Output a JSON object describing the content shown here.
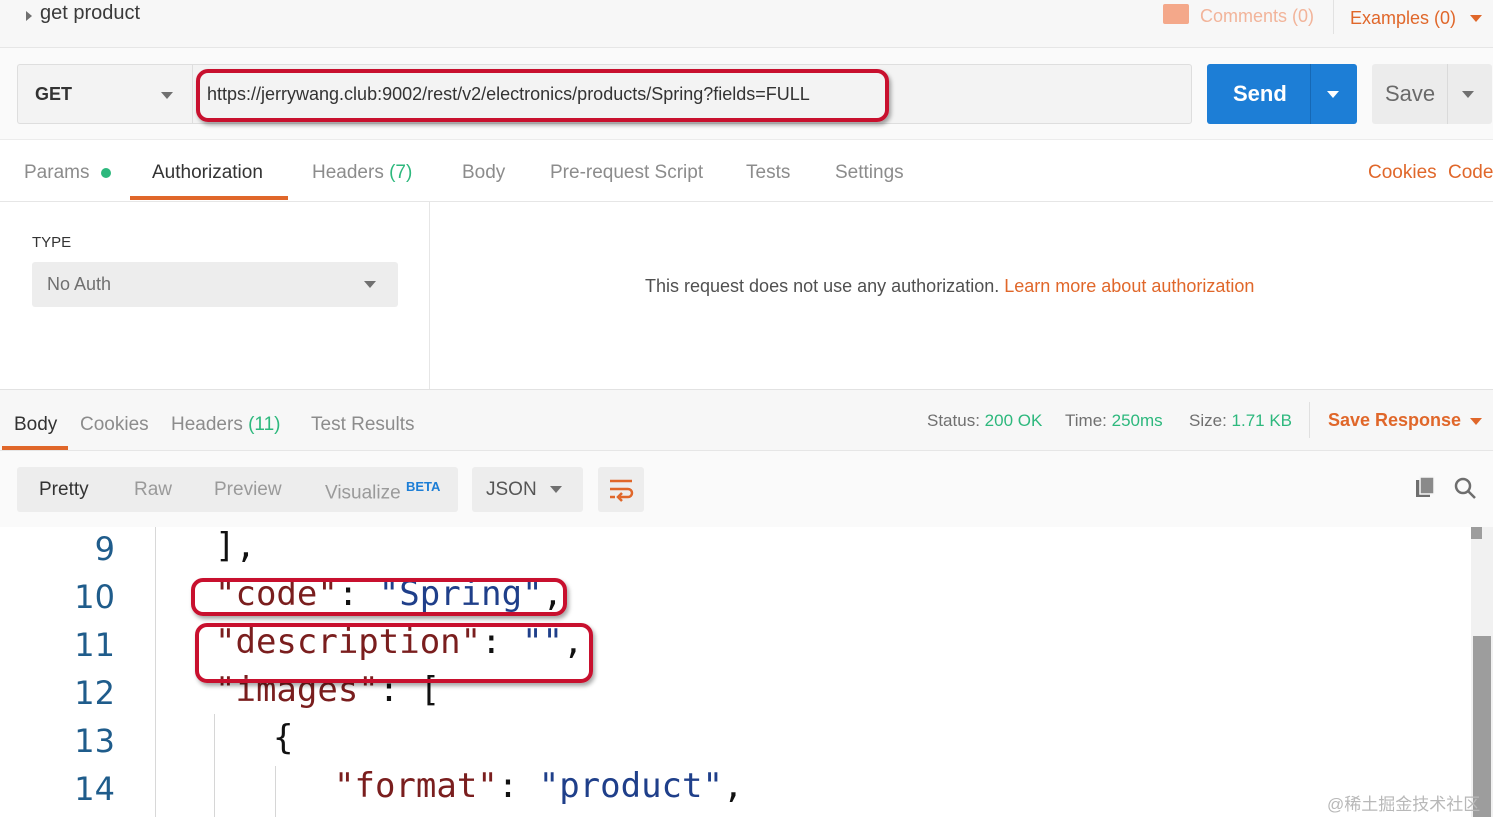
{
  "header": {
    "request_name": "get product",
    "comments_label": "Comments (0)",
    "examples_label": "Examples (0)"
  },
  "request": {
    "method": "GET",
    "url": "https://jerrywang.club:9002/rest/v2/electronics/products/Spring?fields=FULL",
    "send_label": "Send",
    "save_label": "Save"
  },
  "request_tabs": {
    "params": "Params",
    "authorization": "Authorization",
    "headers": "Headers",
    "headers_count": "(7)",
    "body": "Body",
    "prerequest": "Pre-request Script",
    "tests": "Tests",
    "settings": "Settings",
    "cookies": "Cookies",
    "code": "Code",
    "active": "Authorization"
  },
  "auth": {
    "type_label": "TYPE",
    "type_value": "No Auth",
    "message": "This request does not use any authorization.",
    "learn_more": "Learn more about authorization"
  },
  "response": {
    "tabs": {
      "body": "Body",
      "cookies": "Cookies",
      "headers": "Headers",
      "headers_count": "(11)",
      "test_results": "Test Results"
    },
    "status_label": "Status:",
    "status_value": "200 OK",
    "time_label": "Time:",
    "time_value": "250ms",
    "size_label": "Size:",
    "size_value": "1.71 KB",
    "save_response": "Save Response"
  },
  "view": {
    "pretty": "Pretty",
    "raw": "Raw",
    "preview": "Preview",
    "visualize": "Visualize",
    "beta": "BETA",
    "format": "JSON"
  },
  "code_lines": [
    {
      "num": "9"
    },
    {
      "num": "10"
    },
    {
      "num": "11"
    },
    {
      "num": "12"
    },
    {
      "num": "13"
    },
    {
      "num": "14"
    }
  ],
  "code": {
    "l9": "],",
    "l10_key": "\"code\"",
    "l10_val": "\"Spring\"",
    "l11_key": "\"description\"",
    "l11_val": "\"\"",
    "l12_key": "\"images\"",
    "l12_rest": ": [",
    "l13": "{",
    "l14_key": "\"format\"",
    "l14_val": "\"product\""
  },
  "watermark": "@稀土掘金技术社区",
  "colors": {
    "accent_orange": "#e0672a",
    "send_blue": "#1d7ed6",
    "status_green": "#2db87d",
    "highlight_red": "#c8102e"
  }
}
